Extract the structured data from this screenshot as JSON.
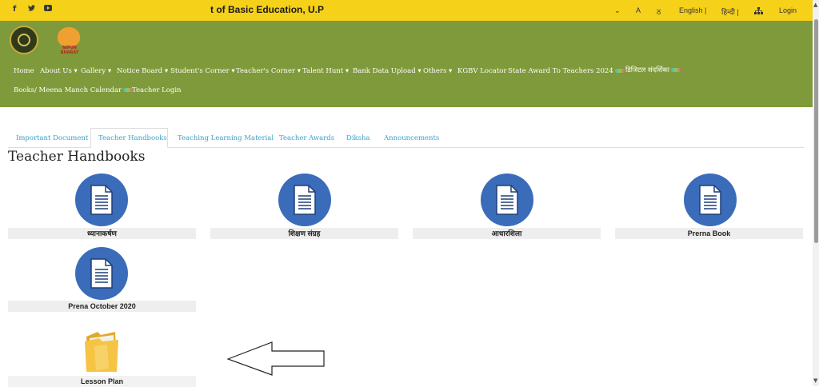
{
  "topbar": {
    "social": [
      "f",
      "🐦",
      "▶"
    ],
    "marquee": "t of Basic Education, U.P",
    "font_controls": [
      "A",
      "ठ"
    ],
    "lang_english": "English |",
    "lang_hindi": "हिन्दी |",
    "login": "Login"
  },
  "logo2_text": "NIPUN BHARAT",
  "nav": {
    "row1": [
      "Home",
      "About Us ▾",
      "Gallery ▾",
      "Notice Board ▾",
      "Student's Corner ▾",
      "Teacher's Corner ▾",
      "Talent Hunt ▾",
      "Bank Data Upload ▾",
      "Others ▾",
      "KGBV Locator",
      "State Award To Teachers 2024",
      "डिजिटल संदर्शिका"
    ],
    "row2": [
      "Books/ Meena Manch Calendar",
      "Teacher Login"
    ]
  },
  "tabs": [
    "Important Document",
    "Teacher Handbooks",
    "Teaching Learning Material",
    "Teacher Awards",
    "Diksha",
    "Announcements"
  ],
  "page_title": "Teacher Handbooks",
  "cards": [
    "ध्यानाकर्षण",
    "शिक्षण संग्रह",
    "आधारशिला",
    "Prerna Book",
    "Prena October 2020"
  ],
  "folder_label": "Lesson Plan",
  "colors": {
    "topbar": "#f6d11a",
    "header": "#7f9a3a",
    "doc_circle": "#3a6cba",
    "tab_link": "#3aa0c8"
  }
}
